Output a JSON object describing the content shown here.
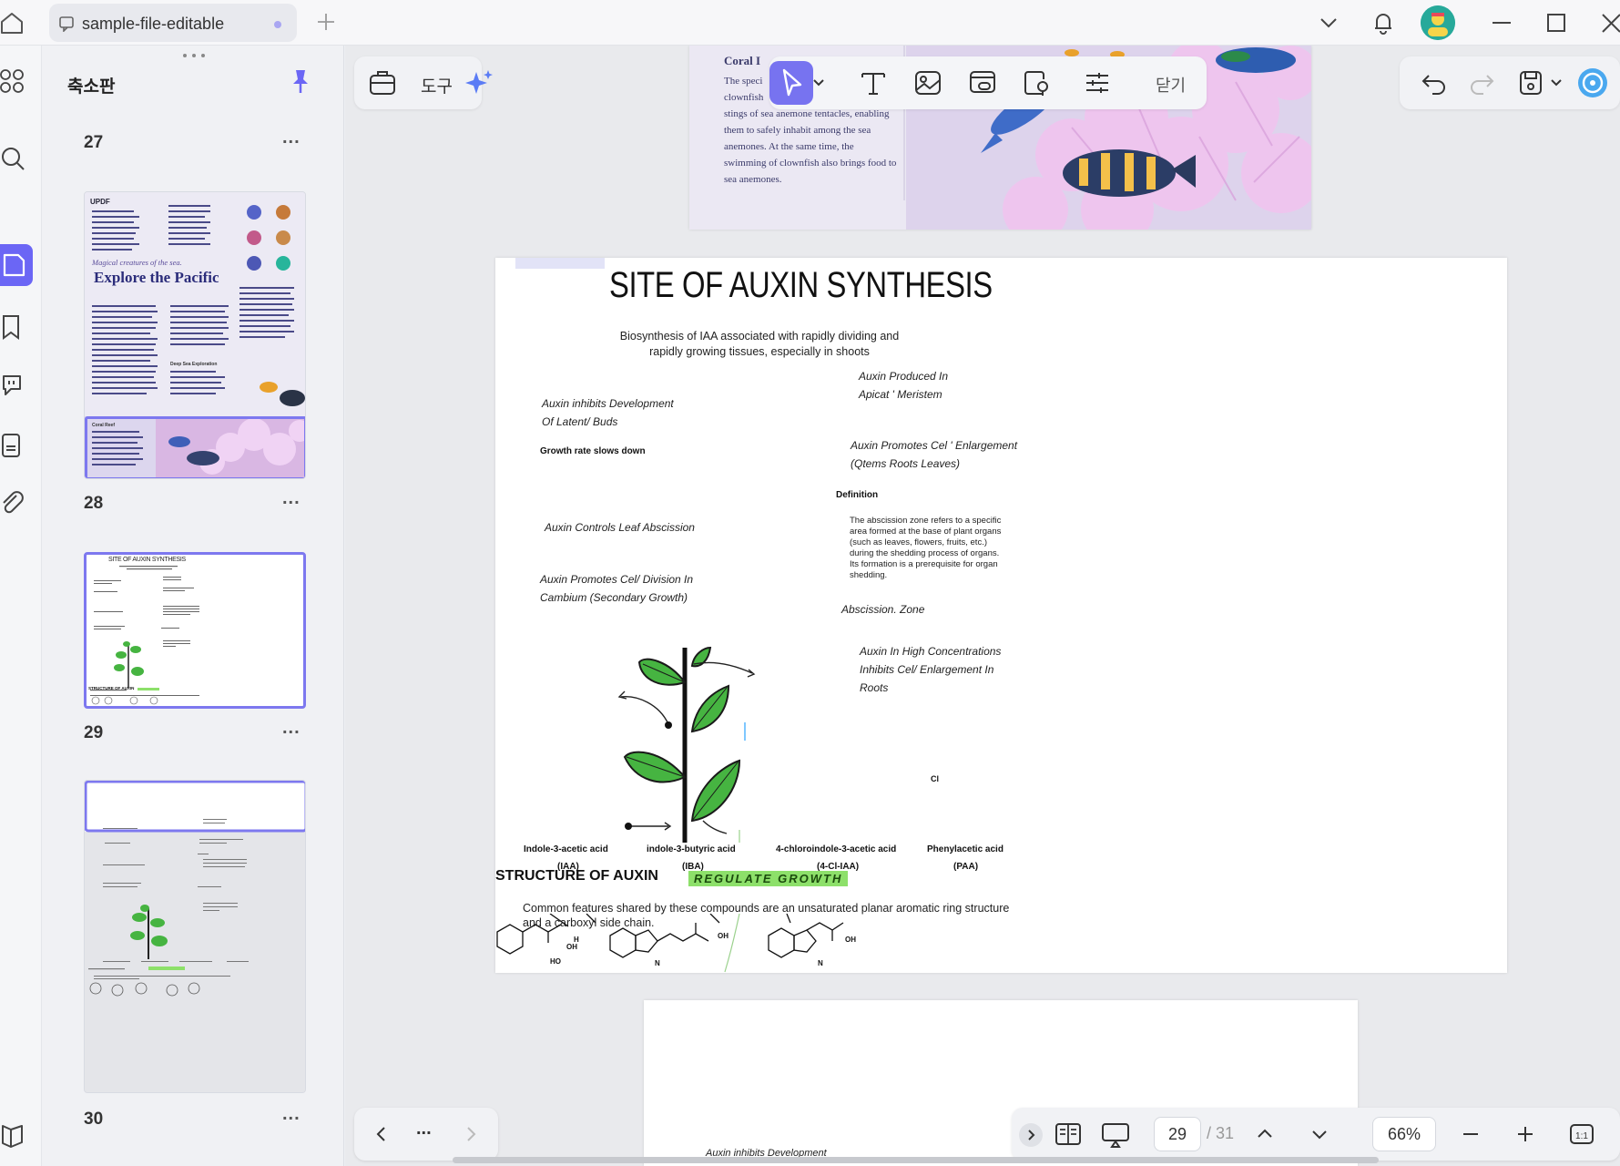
{
  "tab": {
    "file_name": "sample-file-editable"
  },
  "thumbnails": {
    "panel_title": "축소판",
    "pages": [
      {
        "number": "27"
      },
      {
        "number": "28"
      },
      {
        "number": "29"
      },
      {
        "number": "30"
      }
    ],
    "more_label": "...",
    "p28_header": "UPDF",
    "p28_kicker": "Magical creatures of the sea.",
    "p28_title": "Explore the Pacific",
    "p28_sub": "Deep Sea Exploration",
    "p28_coral": "Coral Reef",
    "p29_title": "SITE OF AUXIN SYNTHESIS",
    "p29_struct": "STRUCTURE OF AUXIN"
  },
  "toolbar": {
    "tools_label": "도구",
    "close_label": "닫기"
  },
  "coral_page": {
    "heading": "Coral I",
    "lines": [
      "The speci",
      "clownfish",
      "stings of sea anemone tentacles, enabling",
      "them to safely inhabit among the sea",
      "anemones. At the same time, the",
      "swimming of clownfish also brings food to",
      "sea anemones."
    ]
  },
  "page29": {
    "title": "SITE OF AUXIN SYNTHESIS",
    "subtitle_1": "Biosynthesis of IAA associated with rapidly dividing and",
    "subtitle_2": "rapidly growing tissues, especially in shoots",
    "left_1a": "Auxin inhibits Development",
    "left_1b": "Of Latent/ Buds",
    "left_2": "Growth rate slows down",
    "left_3": "Auxin Controls Leaf Abscission",
    "left_4a": "Auxin Promotes Cel/ Division In",
    "left_4b": "Cambium (Secondary Growth)",
    "right_1a": "Auxin Produced In",
    "right_1b": "Apicat ' Meristem",
    "right_2a": "Auxin Promotes Cel ' Enlargement",
    "right_2b": "(Qtems Roots Leaves)",
    "definition_label": "Definition",
    "definition_text": "The abscission zone refers to a specific area formed at the base of plant organs (such as leaves, flowers, fruits, etc.) during the shedding process of organs. Its formation is a prerequisite for organ shedding.",
    "abscission": "Abscission. Zone",
    "right_3a": "Auxin In High Concentrations",
    "right_3b": "Inhibits Cel/ Enlargement In",
    "right_3c": "Roots",
    "cl": "Cl",
    "comp_1": "Indole-3-acetic acid",
    "comp_1_abbr": "(IAA)",
    "comp_2": "indole-3-butyric acid",
    "comp_2_abbr": "(IBA)",
    "comp_3": "4-chloroindole-3-acetic acid",
    "comp_3_abbr": "(4-Cl-IAA)",
    "comp_4": "Phenylacetic acid",
    "comp_4_abbr": "(PAA)",
    "structure_head": "STRUCTURE OF AUXIN",
    "regulate": "REGULATE GROWTH",
    "common_1": "Common features shared by these compounds are an unsaturated planar aromatic ring structure",
    "common_2": "and a carboxyl side chain.",
    "oh": "OH",
    "ho": "HO",
    "h": "H",
    "n": "N"
  },
  "next_page": {
    "snippet": "Auxin inhibits Development"
  },
  "navigator": {
    "more_label": "...",
    "current_page": "29",
    "total_pages": "/ 31",
    "zoom": "66%"
  },
  "colors": {
    "accent": "#6b66f5",
    "highlight_green": "#8de06a",
    "leaf_green": "#46b441"
  }
}
